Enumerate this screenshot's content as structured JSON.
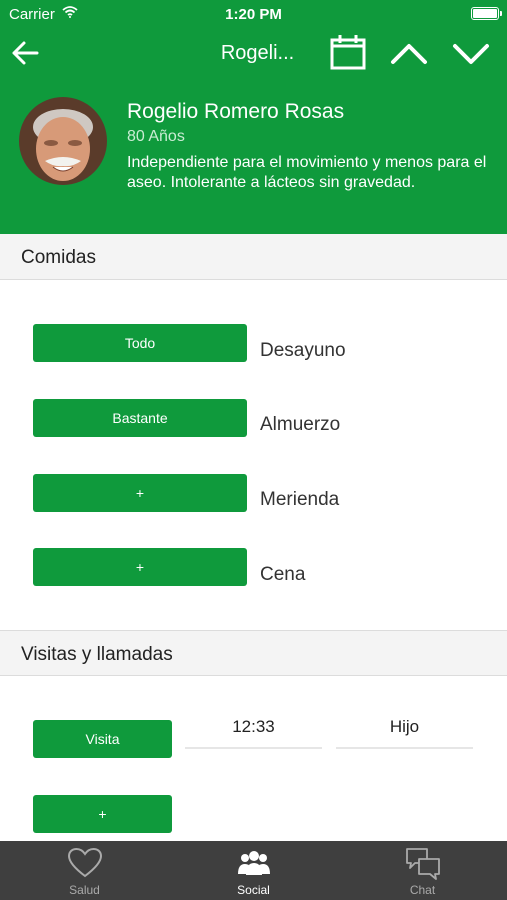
{
  "colors": {
    "brand": "#0f9a3c",
    "tabbar": "#3f3f3f",
    "section_bg": "#f4f4f4"
  },
  "status_bar": {
    "carrier": "Carrier",
    "time": "1:20 PM"
  },
  "navbar": {
    "title": "Rogeli...",
    "icons": [
      "back-arrow-icon",
      "calendar-icon",
      "chevron-up-icon",
      "chevron-down-icon"
    ]
  },
  "profile": {
    "name": "Rogelio Romero Rosas",
    "age": "80 Años",
    "description": "Independiente para el movimiento y menos para el aseo. Intolerante a lácteos sin gravedad."
  },
  "comidas": {
    "title": "Comidas",
    "meals": [
      {
        "button": "Todo",
        "label": "Desayuno"
      },
      {
        "button": "Bastante",
        "label": "Almuerzo"
      },
      {
        "button": "+",
        "label": "Merienda"
      },
      {
        "button": "+",
        "label": "Cena"
      }
    ]
  },
  "visitas": {
    "title": "Visitas y llamadas",
    "entry": {
      "type": "Visita",
      "time": "12:33",
      "who": "Hijo"
    },
    "add_label": "+"
  },
  "tabbar": {
    "tabs": [
      {
        "label": "Salud",
        "icon": "heart-icon",
        "active": false
      },
      {
        "label": "Social",
        "icon": "people-icon",
        "active": true
      },
      {
        "label": "Chat",
        "icon": "chat-bubbles-icon",
        "active": false
      }
    ]
  }
}
